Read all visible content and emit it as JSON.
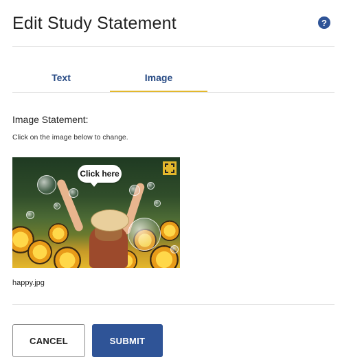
{
  "header": {
    "title": "Edit Study Statement",
    "help_icon": "question-mark-icon",
    "help_symbol": "?"
  },
  "tabs": [
    {
      "label": "Text",
      "active": false
    },
    {
      "label": "Image",
      "active": true
    }
  ],
  "statement": {
    "label": "Image Statement:",
    "hint": "Click on the image below to change.",
    "image_overlay_text": "Click here",
    "expand_icon": "fullscreen-expand-icon",
    "filename": "happy.jpg"
  },
  "actions": {
    "cancel_label": "CANCEL",
    "submit_label": "SUBMIT"
  },
  "colors": {
    "primary": "#2f5497",
    "accent": "#e3b82c"
  }
}
